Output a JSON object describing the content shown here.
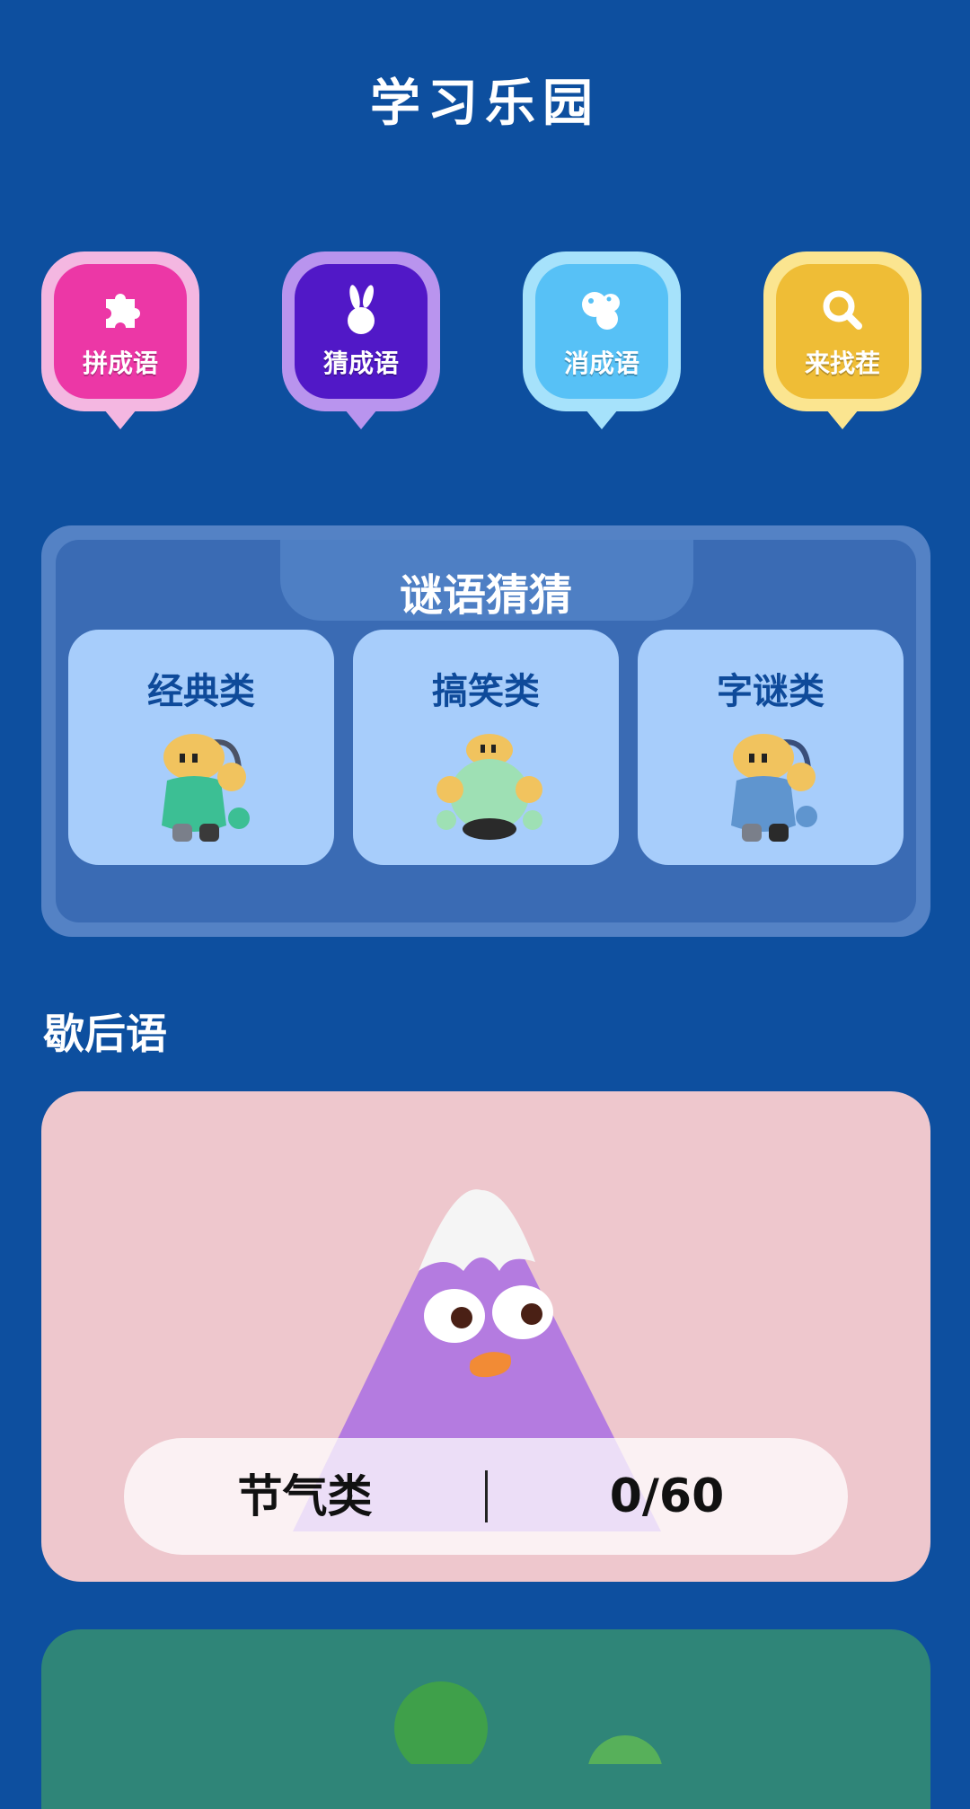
{
  "header": {
    "title": "学习乐园"
  },
  "games": [
    {
      "label": "拼成语",
      "icon": "puzzle-icon",
      "color": "#ec37a6"
    },
    {
      "label": "猜成语",
      "icon": "rabbit-icon",
      "color": "#5118c7"
    },
    {
      "label": "消成语",
      "icon": "bubbles-icon",
      "color": "#57c1f6"
    },
    {
      "label": "来找茬",
      "icon": "magnifier-icon",
      "color": "#efbd36"
    }
  ],
  "riddles": {
    "title": "谜语猜猜",
    "categories": [
      {
        "label": "经典类",
        "icon": "robot-mascot-green"
      },
      {
        "label": "搞笑类",
        "icon": "robot-mascot-round"
      },
      {
        "label": "字谜类",
        "icon": "robot-mascot-blue"
      }
    ]
  },
  "xiehouyu": {
    "title": "歇后语",
    "cards": [
      {
        "category": "节气类",
        "progress": "0/60",
        "icon": "mountain-mascot",
        "color": "#eec7cd"
      }
    ]
  },
  "colors": {
    "background": "#0d4f9f",
    "next_card": "#2f8578"
  }
}
